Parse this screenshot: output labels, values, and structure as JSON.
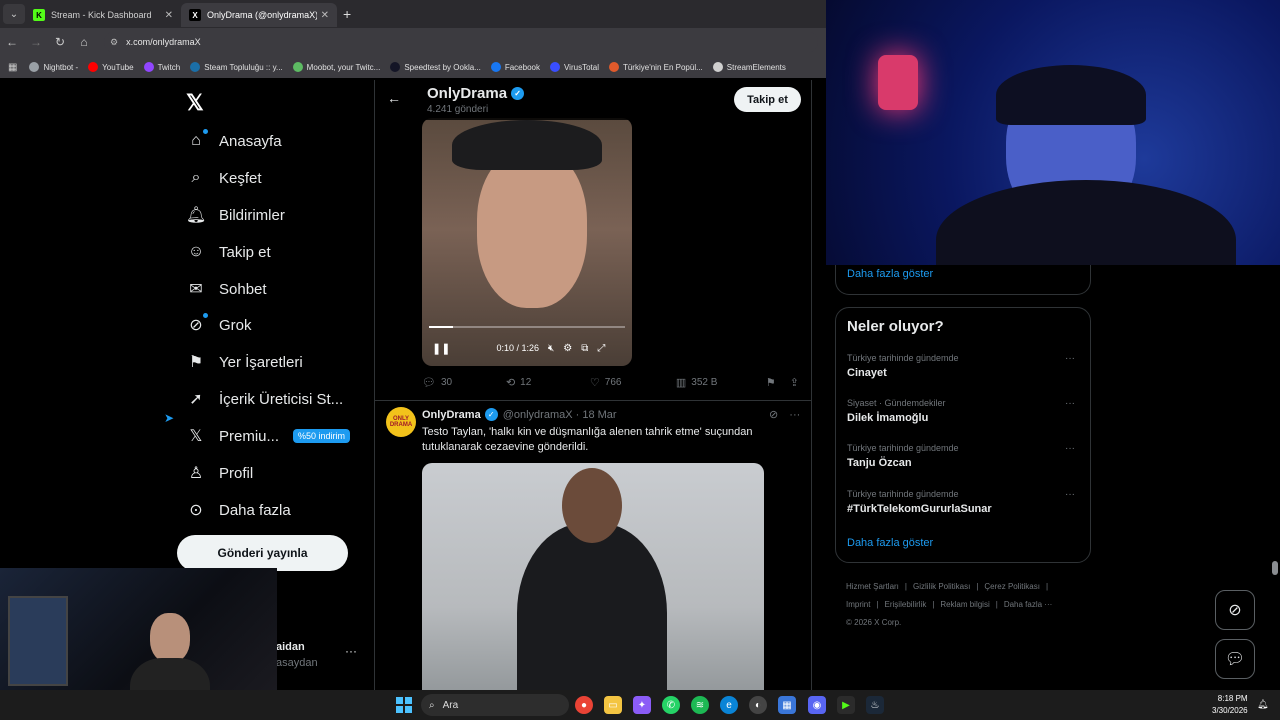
{
  "browser": {
    "tabs": [
      {
        "title": "Stream - Kick Dashboard",
        "favicon": "K",
        "active": false
      },
      {
        "title": "OnlyDrama (@onlydramaX) / X",
        "favicon": "X",
        "active": true
      }
    ],
    "url": "x.com/onlydramaX",
    "bookmarks": [
      {
        "label": "Nightbot -",
        "color": "#9aa0a6"
      },
      {
        "label": "YouTube",
        "color": "#ff0000"
      },
      {
        "label": "Twitch",
        "color": "#9146ff"
      },
      {
        "label": "Steam Topluluğu :: y...",
        "color": "#1b6fa8"
      },
      {
        "label": "Moobot, your Twitc...",
        "color": "#5dbb63"
      },
      {
        "label": "Speedtest by Ookla...",
        "color": "#141526"
      },
      {
        "label": "Facebook",
        "color": "#1877f2"
      },
      {
        "label": "VirusTotal",
        "color": "#394eff"
      },
      {
        "label": "Türkiye'nin En Popül...",
        "color": "#e05a2b"
      },
      {
        "label": "StreamElements",
        "color": "#cfcfcf"
      }
    ]
  },
  "nav": {
    "items": [
      {
        "label": "Anasayfa",
        "icon": "home-icon"
      },
      {
        "label": "Keşfet",
        "icon": "search-icon"
      },
      {
        "label": "Bildirimler",
        "icon": "bell-icon"
      },
      {
        "label": "Takip et",
        "icon": "follow-icon"
      },
      {
        "label": "Sohbet",
        "icon": "mail-icon"
      },
      {
        "label": "Grok",
        "icon": "grok-icon"
      },
      {
        "label": "Yer İşaretleri",
        "icon": "bookmark-icon"
      },
      {
        "label": "İçerik Üreticisi St...",
        "icon": "rocket-icon"
      },
      {
        "label": "Premiu...",
        "icon": "x-icon"
      },
      {
        "label": "Profil",
        "icon": "profile-icon"
      },
      {
        "label": "Daha fazla",
        "icon": "more-icon"
      }
    ],
    "premium_badge": "%50 indirim",
    "post_button": "Gönderi yayınla",
    "user_name": "aidan",
    "user_handle": "asaydan"
  },
  "profile": {
    "name": "OnlyDrama",
    "post_count": "4.241 gönderi",
    "follow_label": "Takip et"
  },
  "video": {
    "time": "0:10 / 1:26",
    "progress": 0.12
  },
  "tweet1_actions": {
    "replies": "30",
    "reposts": "12",
    "likes": "766",
    "views": "352 B"
  },
  "tweet2": {
    "name": "OnlyDrama",
    "handle": "@onlydramaX · 18 Mar",
    "avatar_text": "ONLY DRAMA",
    "text": "Testo Taylan, 'halkı kin ve düşmanlığa alenen tahrik etme' suçundan tutuklanarak cezaevine gönderildi."
  },
  "sidebar": {
    "show_more": "Daha fazla göster",
    "trends_title": "Neler oluyor?",
    "trends": [
      {
        "context": "Türkiye tarihinde gündemde",
        "topic": "Cinayet"
      },
      {
        "context": "Siyaset · Gündemdekiler",
        "topic": "Dilek İmamoğlu"
      },
      {
        "context": "Türkiye tarihinde gündemde",
        "topic": "Tanju Özcan"
      },
      {
        "context": "Türkiye tarihinde gündemde",
        "topic": "#TürkTelekomGururlaSunar"
      }
    ],
    "footer": [
      "Hizmet Şartları",
      "|",
      "Gizlilik Politikası",
      "|",
      "Çerez Politikası",
      "|",
      "Imprint",
      "|",
      "Erişilebilirlik",
      "|",
      "Reklam bilgisi",
      "|",
      "Daha fazla ···",
      "© 2026 X Corp."
    ]
  },
  "taskbar": {
    "search_placeholder": "Ara",
    "time": "8:18 PM",
    "date": "3/30/2026"
  }
}
